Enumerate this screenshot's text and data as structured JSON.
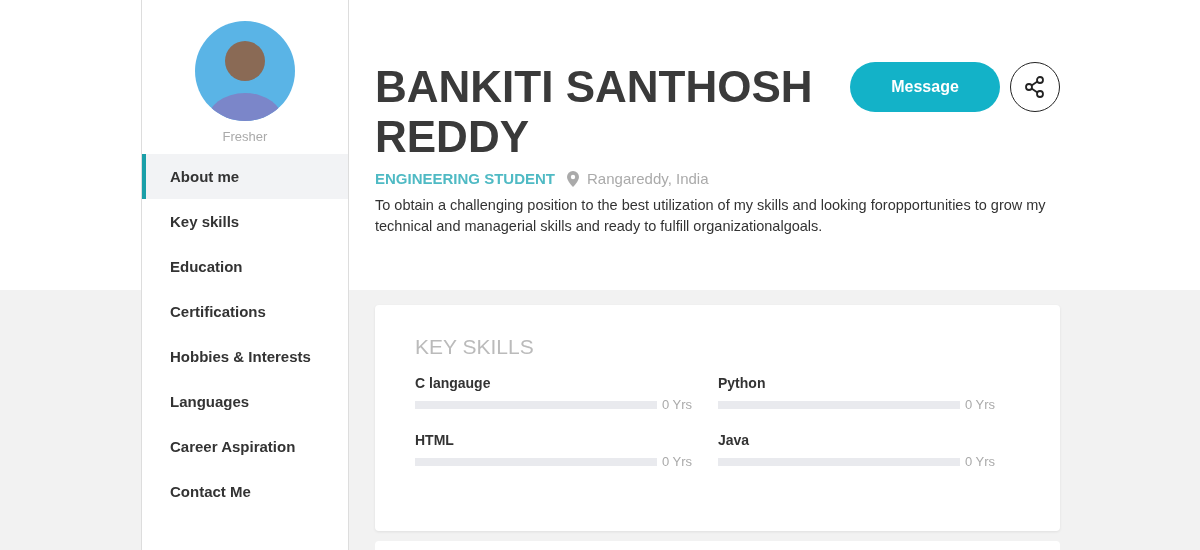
{
  "sidebar": {
    "status": "Fresher",
    "items": [
      {
        "label": "About me",
        "selected": true
      },
      {
        "label": "Key skills",
        "selected": false
      },
      {
        "label": "Education",
        "selected": false
      },
      {
        "label": "Certifications",
        "selected": false
      },
      {
        "label": "Hobbies & Interests",
        "selected": false
      },
      {
        "label": "Languages",
        "selected": false
      },
      {
        "label": "Career Aspiration",
        "selected": false
      },
      {
        "label": "Contact Me",
        "selected": false
      }
    ]
  },
  "profile": {
    "name": "BANKITI SANTHOSH REDDY",
    "role": "ENGINEERING STUDENT",
    "location": "Rangareddy, India",
    "summary": "To obtain a challenging position to the best utilization of my skills and looking foropportunities to grow my technical and managerial skills and ready to fulfill organizationalgoals.",
    "message_button": "Message"
  },
  "key_skills": {
    "title": "KEY SKILLS",
    "skills": [
      {
        "name": "C langauge",
        "level": 0,
        "experience": "0 Yrs"
      },
      {
        "name": "Python",
        "level": 0,
        "experience": "0 Yrs"
      },
      {
        "name": "HTML",
        "level": 0,
        "experience": "0 Yrs"
      },
      {
        "name": "Java",
        "level": 0,
        "experience": "0 Yrs"
      }
    ]
  }
}
